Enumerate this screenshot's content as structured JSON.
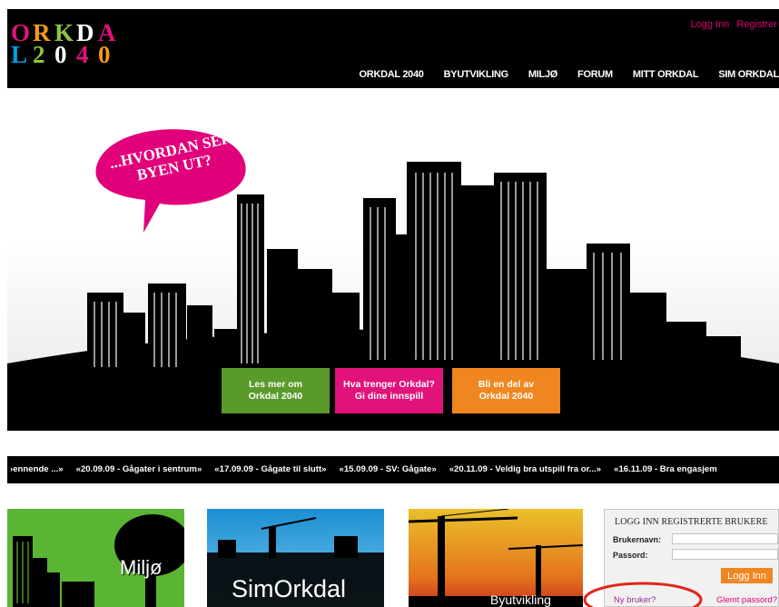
{
  "header": {
    "logo_line1": [
      "O",
      "R",
      "K",
      "D",
      "A"
    ],
    "logo_line2": [
      "L",
      "2",
      "0",
      "4",
      "0"
    ],
    "logo_colors1": [
      "#e0127a",
      "#f39a1e",
      "#8cc63f",
      "#ffffff",
      "#e0127a"
    ],
    "logo_colors2": [
      "#00a0e0",
      "#8cc63f",
      "#ffffff",
      "#e0127a",
      "#f39a1e"
    ],
    "auth": {
      "login": "Logg Inn",
      "register": "Registrer"
    },
    "nav": [
      "ORKDAL 2040",
      "BYUTVIKLING",
      "MILJØ",
      "FORUM",
      "MITT ORKDAL",
      "SIM ORKDAL"
    ]
  },
  "hero": {
    "bubble": "...HVORDAN SER BYEN UT?",
    "cta": [
      {
        "label": "Les mer om\nOrkdal 2040",
        "color": "#5a9a2b"
      },
      {
        "label": "Hva trenger Orkdal?\nGi dine innspill",
        "color": "#e1137a"
      },
      {
        "label": "Bli en del av\nOrkdal 2040",
        "color": "#ef8620"
      }
    ]
  },
  "ticker": [
    "›ennende ...»",
    "«20.09.09  - Gågater i sentrum»",
    "«17.09.09  - Gågate til slutt»",
    "«15.09.09  - SV: Gågate»",
    "«20.11.09  - Veldig bra utspill fra or...»",
    "«16.11.09  - Bra engasjem"
  ],
  "panels": {
    "miljo": "Miljø",
    "sim": "SimOrkdal",
    "byut": "Byutvikling"
  },
  "login": {
    "title": "LOGG INN REGISTRERTE BRUKERE",
    "username_label": "Brukernavn:",
    "password_label": "Passord:",
    "button": "Logg Inn",
    "new_user": "Ny bruker?",
    "forgot": "Glemt passord?"
  },
  "colors": {
    "accent_pink": "#e2007a",
    "accent_green": "#5a9a2b",
    "accent_orange": "#ef8620",
    "annotation_red": "#e0261b"
  }
}
